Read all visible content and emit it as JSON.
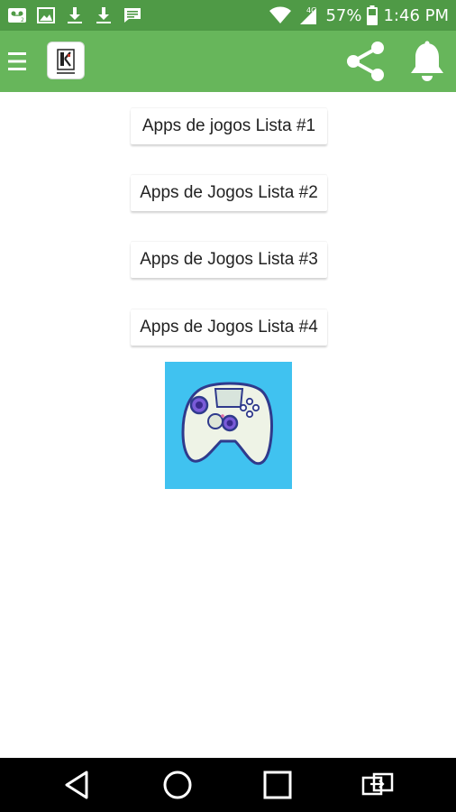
{
  "status_bar": {
    "battery": "57%",
    "time": "1:46 PM",
    "network": "4G",
    "icons": [
      "voicemail-icon",
      "image-icon",
      "download-icon",
      "download-icon",
      "message-icon",
      "wifi-icon",
      "signal-icon",
      "battery-icon"
    ]
  },
  "app_bar": {
    "color": "#67b65b",
    "icons": [
      "menu-icon",
      "app-logo",
      "share-icon",
      "bell-icon"
    ]
  },
  "lists": [
    {
      "label": "Apps de jogos Lista #1"
    },
    {
      "label": "Apps de Jogos Lista #2"
    },
    {
      "label": "Apps de Jogos Lista #3"
    },
    {
      "label": "Apps de Jogos Lista #4"
    }
  ],
  "image": {
    "icon": "game-controller-icon",
    "background": "#40c2f0"
  },
  "nav_bar": {
    "icons": [
      "back-icon",
      "home-icon",
      "recents-icon",
      "switch-sim-icon"
    ]
  }
}
